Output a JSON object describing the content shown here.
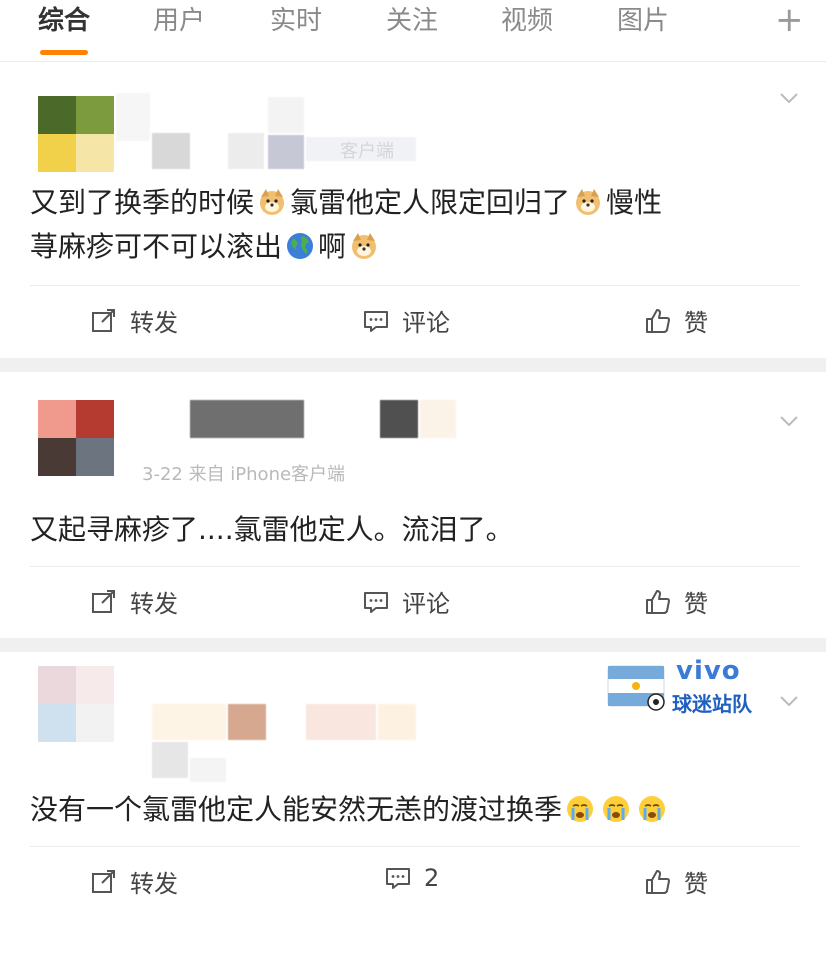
{
  "tabs": [
    {
      "label": "综合",
      "active": true
    },
    {
      "label": "用户"
    },
    {
      "label": "实时"
    },
    {
      "label": "关注"
    },
    {
      "label": "视频"
    },
    {
      "label": "图片"
    }
  ],
  "add_tab_label": "+",
  "posts": [
    {
      "meta": "客户端",
      "content": {
        "p1": "又到了换季的时候",
        "p2": "氯雷他定人限定回归了",
        "p3": "慢性",
        "p4": "荨麻疹可不可以滚出",
        "p5": "啊"
      },
      "actions": {
        "repost": "转发",
        "comment": "评论",
        "like": "赞"
      }
    },
    {
      "meta": "3-22 来自 iPhone客户端",
      "content": {
        "p1": "又起寻麻疹了....氯雷他定人。流泪了。"
      },
      "actions": {
        "repost": "转发",
        "comment": "评论",
        "like": "赞"
      }
    },
    {
      "badge": {
        "brand": "vivo",
        "text": "球迷站队"
      },
      "content": {
        "p1": "没有一个氯雷他定人能安然无恙的渡过换季"
      },
      "actions": {
        "repost": "转发",
        "comment": "2",
        "like": "赞"
      }
    }
  ],
  "colors": {
    "accent": "#ff8200",
    "vivo_blue": "#3a7bd5",
    "badge_blue": "#1f5fbf"
  }
}
